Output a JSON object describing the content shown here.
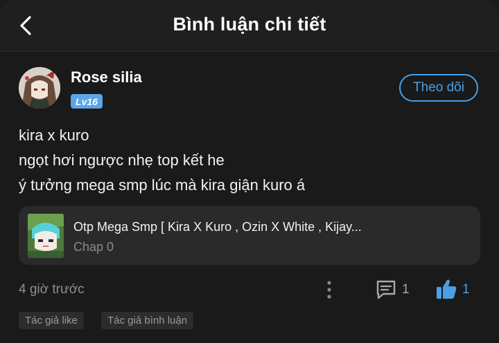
{
  "header": {
    "title": "Bình luận chi tiết",
    "back_icon": "chevron-left-icon"
  },
  "comment": {
    "username": "Rose silia",
    "level": "Lv16",
    "follow_label": "Theo dõi",
    "lines": [
      "kira x kuro",
      "ngọt hơi ngược nhẹ top kết he",
      "ý tưởng mega smp lúc mà kira giận kuro á"
    ],
    "time": "4 giờ trước",
    "reply_count": "1",
    "like_count": "1",
    "tags": [
      "Tác giả like",
      "Tác giả bình luận"
    ]
  },
  "story": {
    "title": "Otp Mega Smp [ Kira X Kuro , Ozin X White , Kijay...",
    "chapter": "Chap 0"
  },
  "colors": {
    "accent": "#4a9fe6",
    "level_badge": "#5aa6e8",
    "background": "#1a1a1a",
    "card": "#2a2a2a"
  }
}
